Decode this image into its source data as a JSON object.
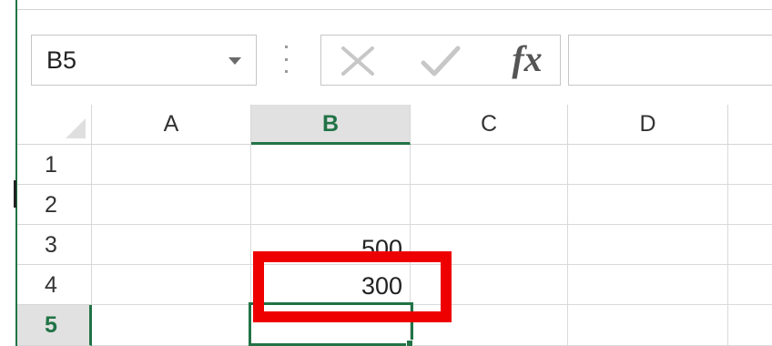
{
  "name_box": {
    "value": "B5"
  },
  "formula_bar": {
    "cancel_icon": "close-icon",
    "enter_icon": "checkmark-icon",
    "fx_label": "fx",
    "value": ""
  },
  "grid": {
    "columns": [
      "A",
      "B",
      "C",
      "D"
    ],
    "rows": [
      "1",
      "2",
      "3",
      "4",
      "5"
    ],
    "selected_column": "B",
    "selected_row": "5",
    "cells": {
      "B3": "500",
      "B4": "300"
    }
  },
  "colors": {
    "accent": "#217346",
    "highlight": "#ee0000",
    "header_selected_bg": "#e1e1e1",
    "gridline": "#dadada"
  }
}
